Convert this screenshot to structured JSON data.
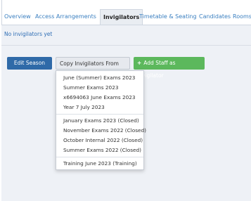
{
  "tabs": [
    {
      "label": "Overview"
    },
    {
      "label": "Access Arrangements"
    },
    {
      "label": "Invigilators"
    },
    {
      "label": "Timetable & Seating"
    },
    {
      "label": "Candidates"
    },
    {
      "label": "Rooms"
    }
  ],
  "notice": "No invigilators yet",
  "toolbar": {
    "edit_season_label": "Edit Season",
    "copy_invigilators_label": "Copy Invigilators From ...",
    "add_staff_label": "Add Staff as Invigilator",
    "add_staff_icon": "+"
  },
  "dropdown": {
    "groups": [
      [
        "June (Summer) Exams 2023",
        "Summer Exams 2023",
        "x6694063 June Exams 2023",
        "Year 7 July 2023"
      ],
      [
        "January Exams 2023 (Closed)",
        "November Exams 2022 (Closed)",
        "October Internal 2022 (Closed)",
        "Summer Exams 2022 (Closed)"
      ],
      [
        "Training June 2023 (Training)"
      ]
    ]
  },
  "colors": {
    "accent": "#2f6aa8",
    "success": "#5cb85c",
    "link": "#3a7fc0"
  }
}
